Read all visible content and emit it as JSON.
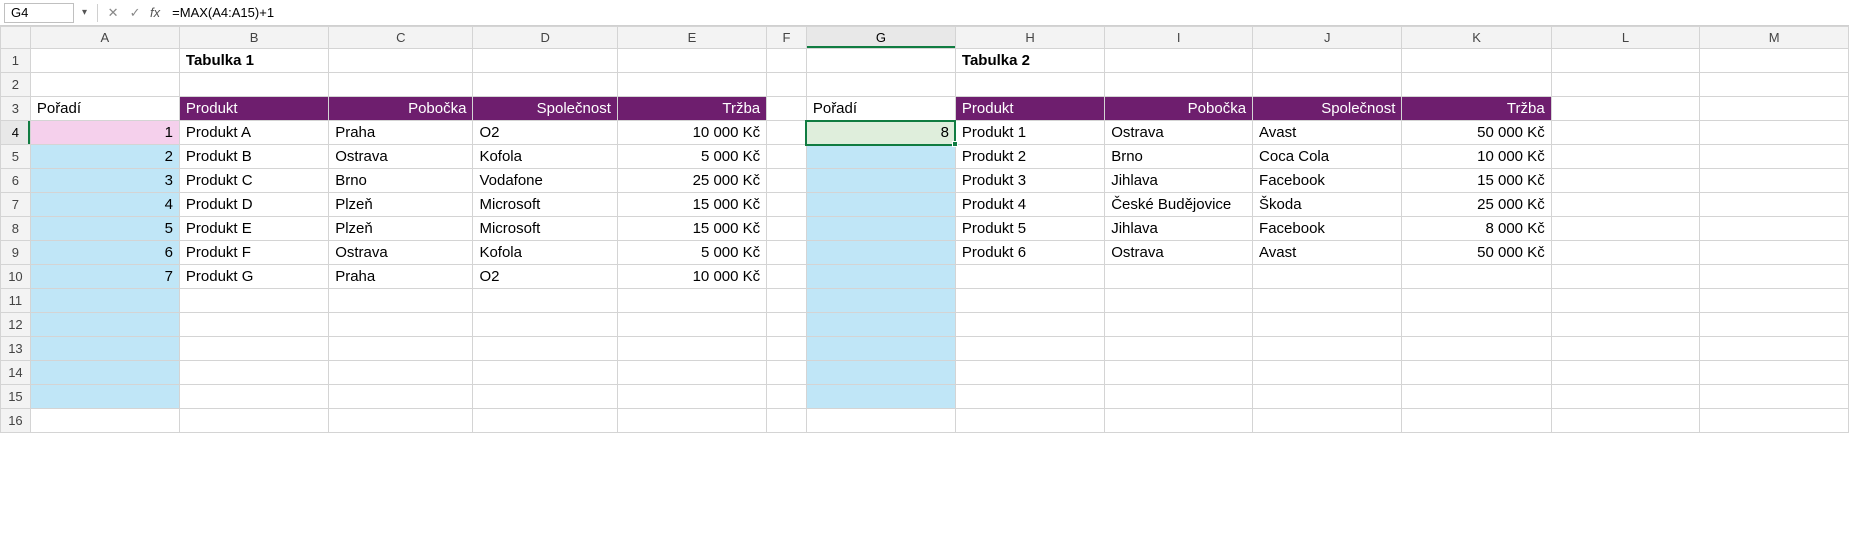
{
  "formula_bar": {
    "name_box": "G4",
    "formula": "=MAX(A4:A15)+1",
    "fx_label": "fx"
  },
  "columns": [
    "A",
    "B",
    "C",
    "D",
    "E",
    "F",
    "G",
    "H",
    "I",
    "J",
    "K",
    "L",
    "M"
  ],
  "row_count": 16,
  "active_cell": "G4",
  "titles": {
    "table1": "Tabulka 1",
    "table2": "Tabulka 2"
  },
  "labels": {
    "poradi": "Pořadí",
    "produkt": "Produkt",
    "pobocka": "Pobočka",
    "spolecnost": "Společnost",
    "trzba": "Tržba"
  },
  "table1": {
    "rows": [
      {
        "poradi": "1",
        "produkt": "Produkt A",
        "pobocka": "Praha",
        "spolecnost": "O2",
        "trzba": "10 000 Kč"
      },
      {
        "poradi": "2",
        "produkt": "Produkt B",
        "pobocka": "Ostrava",
        "spolecnost": "Kofola",
        "trzba": "5 000 Kč"
      },
      {
        "poradi": "3",
        "produkt": "Produkt C",
        "pobocka": "Brno",
        "spolecnost": "Vodafone",
        "trzba": "25 000 Kč"
      },
      {
        "poradi": "4",
        "produkt": "Produkt D",
        "pobocka": "Plzeň",
        "spolecnost": "Microsoft",
        "trzba": "15 000 Kč"
      },
      {
        "poradi": "5",
        "produkt": "Produkt E",
        "pobocka": "Plzeň",
        "spolecnost": "Microsoft",
        "trzba": "15 000 Kč"
      },
      {
        "poradi": "6",
        "produkt": "Produkt F",
        "pobocka": "Ostrava",
        "spolecnost": "Kofola",
        "trzba": "5 000 Kč"
      },
      {
        "poradi": "7",
        "produkt": "Produkt G",
        "pobocka": "Praha",
        "spolecnost": "O2",
        "trzba": "10 000 Kč"
      }
    ]
  },
  "table2": {
    "g4_value": "8",
    "rows": [
      {
        "produkt": "Produkt 1",
        "pobocka": "Ostrava",
        "spolecnost": "Avast",
        "trzba": "50 000 Kč"
      },
      {
        "produkt": "Produkt 2",
        "pobocka": "Brno",
        "spolecnost": "Coca Cola",
        "trzba": "10 000 Kč"
      },
      {
        "produkt": "Produkt 3",
        "pobocka": "Jihlava",
        "spolecnost": "Facebook",
        "trzba": "15 000 Kč"
      },
      {
        "produkt": "Produkt 4",
        "pobocka": "České Budějovice",
        "spolecnost": "Škoda",
        "trzba": "25 000 Kč"
      },
      {
        "produkt": "Produkt 5",
        "pobocka": "Jihlava",
        "spolecnost": "Facebook",
        "trzba": "8 000 Kč"
      },
      {
        "produkt": "Produkt 6",
        "pobocka": "Ostrava",
        "spolecnost": "Avast",
        "trzba": "50 000 Kč"
      }
    ]
  }
}
